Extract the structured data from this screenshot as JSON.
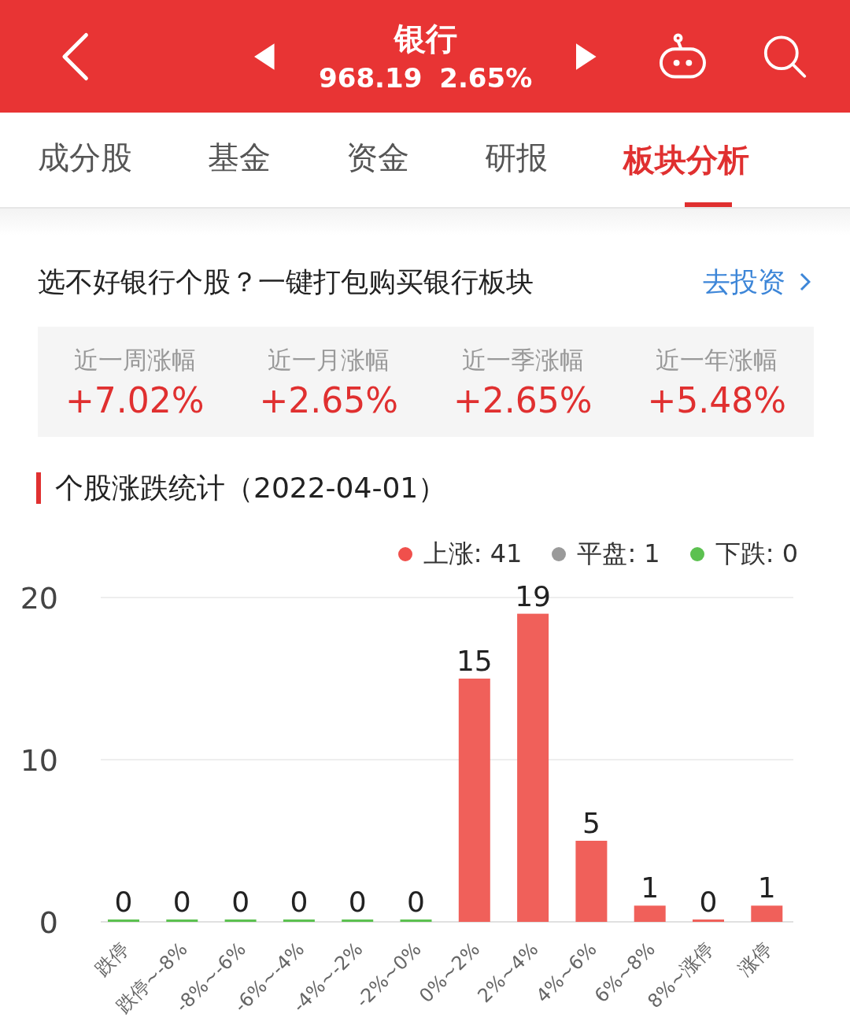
{
  "header": {
    "title": "银行",
    "price": "968.19",
    "change": "2.65%"
  },
  "tabs": [
    {
      "label": "成分股",
      "selected": false
    },
    {
      "label": "基金",
      "selected": false
    },
    {
      "label": "资金",
      "selected": false
    },
    {
      "label": "研报",
      "selected": false
    },
    {
      "label": "板块分析",
      "selected": true
    }
  ],
  "promo": {
    "text": "选不好银行个股？一键打包购买银行板块",
    "link": "去投资"
  },
  "returns": [
    {
      "label": "近一周涨幅",
      "value": "+7.02%"
    },
    {
      "label": "近一月涨幅",
      "value": "+2.65%"
    },
    {
      "label": "近一季涨幅",
      "value": "+2.65%"
    },
    {
      "label": "近一年涨幅",
      "value": "+5.48%"
    }
  ],
  "stats_section": {
    "title": "个股涨跌统计（2022-04-01）",
    "legend": [
      {
        "label": "上涨: 41",
        "color": "#f0504c"
      },
      {
        "label": "平盘: 1",
        "color": "#9a9a9a"
      },
      {
        "label": "下跌: 0",
        "color": "#5cc150"
      }
    ],
    "chart_data": {
      "type": "bar",
      "data_labels": true,
      "categories": [
        "跌停",
        "跌停~-8%",
        "-8%~-6%",
        "-6%~-4%",
        "-4%~-2%",
        "-2%~0%",
        "0%~2%",
        "2%~4%",
        "4%~6%",
        "6%~8%",
        "8%~涨停",
        "涨停"
      ],
      "series": [
        {
          "color": "#5cc150",
          "values": [
            0,
            0,
            0,
            0,
            0,
            0,
            null,
            null,
            null,
            null,
            null,
            null
          ]
        },
        {
          "color": "#f0605a",
          "values": [
            null,
            null,
            null,
            null,
            null,
            null,
            15,
            19,
            5,
            1,
            0,
            1
          ]
        }
      ],
      "ylim": [
        0,
        20
      ],
      "yticks": [
        0,
        10,
        20
      ]
    }
  }
}
